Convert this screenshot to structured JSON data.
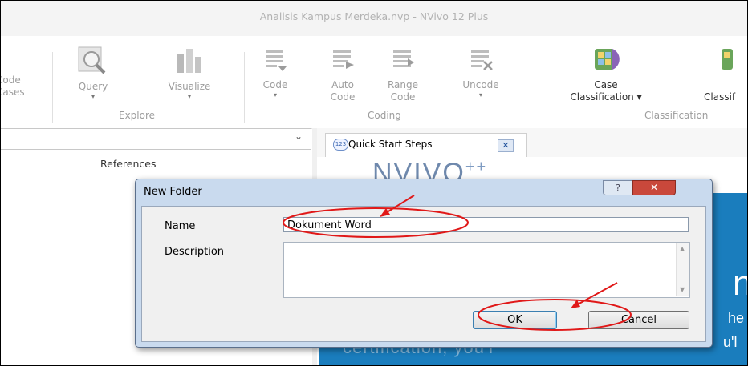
{
  "window": {
    "title": "Analisis Kampus Merdeka.nvp - NVivo 12 Plus"
  },
  "ribbon": {
    "partial_left": {
      "line1": "Code",
      "line2": "Cases"
    },
    "explore": {
      "query": "Query",
      "visualize": "Visualize",
      "group_label": "Explore"
    },
    "coding": {
      "code": "Code",
      "auto_code_line1": "Auto",
      "auto_code_line2": "Code",
      "range_code_line1": "Range",
      "range_code_line2": "Code",
      "uncode": "Uncode",
      "group_label": "Coding"
    },
    "classification": {
      "case_classification_line1": "Case",
      "case_classification_line2": "Classification ▾",
      "partial_right": "Classif",
      "group_label": "Classification"
    },
    "dropdown_arrow": "▾"
  },
  "left_panel": {
    "column_header": "References",
    "combo_chevron": "⌄"
  },
  "tabs": [
    {
      "label": "Quick Start Steps",
      "icon": "123"
    }
  ],
  "tab_close_glyph": "✕",
  "welcome": {
    "logo": "NVIVO",
    "logo_plus": "++",
    "banner_text_1": "n",
    "banner_text_2": "he",
    "banner_text_3": "u'l",
    "banner_certification": "certification, you'l"
  },
  "dialog": {
    "title": "New Folder",
    "help_glyph": "?",
    "close_glyph": "✕",
    "name_label": "Name",
    "name_value": "Dokument Word",
    "description_label": "Description",
    "ok_label": "OK",
    "cancel_label": "Cancel"
  },
  "colors": {
    "annotation_red": "#e01818",
    "banner_blue": "#1a7dbd",
    "dialog_frame": "#c9daee"
  }
}
